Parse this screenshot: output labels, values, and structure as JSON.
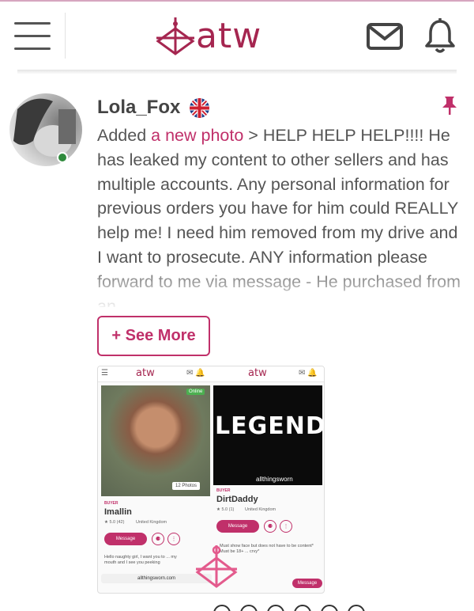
{
  "header": {
    "logo_text": "atw",
    "accent_color": "#a52650",
    "icons": [
      "menu-icon",
      "mail-icon",
      "bell-icon"
    ]
  },
  "post": {
    "username": "Lola_Fox",
    "flag": "uk-flag-icon",
    "online": true,
    "added_prefix": "Added ",
    "added_link": "a new photo",
    "body_text": " > HELP HELP HELP!!!! He has leaked my content to other sellers and has multiple accounts. Any personal information for previous orders you have for him could REALLY help me! I need him removed from my drive and I want to prosecute. ANY information please forward to me via message - He purchased from an",
    "see_more_label": "+ See More",
    "pinned": true
  },
  "attachment": {
    "left_logo": "atw",
    "right_logo": "atw",
    "left_card": {
      "online_label": "Online",
      "photos_label": "12 Photos",
      "role": "BUYER",
      "name": "Imallin",
      "rating": "★ 5.0 (42)",
      "country": "United Kingdom",
      "message_label": "Message",
      "bio": "Hello naughty girl, I want you to ... my mouth and I see you peeking"
    },
    "right_card": {
      "banner_text": "LEGEND",
      "banner_sub": "allthingsworn",
      "role": "BUYER",
      "name": "DirtDaddy",
      "rating": "★ 5.0 (1)",
      "country": "United Kingdom",
      "message_label": "Message",
      "bio": "Must show face but does not have to be content* Must be 18+ ... crvy*"
    },
    "url": "allthingsworn.com",
    "bottom_message_label": "Message"
  }
}
